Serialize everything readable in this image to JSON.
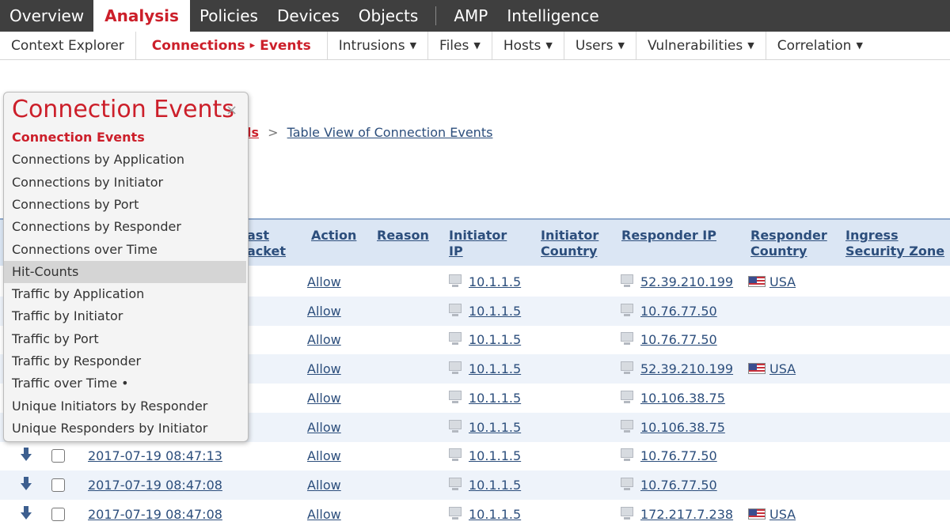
{
  "topnav": {
    "items": [
      "Overview",
      "Analysis",
      "Policies",
      "Devices",
      "Objects",
      "AMP",
      "Intelligence"
    ],
    "active": "Analysis"
  },
  "subnav": {
    "context_explorer": "Context Explorer",
    "connections": "Connections",
    "events": "Events",
    "arrow": "▸",
    "intrusions": "Intrusions",
    "files": "Files",
    "hosts": "Hosts",
    "users": "Users",
    "vulnerabilities": "Vulnerabilities",
    "correlation": "Correlation",
    "caret": "▼"
  },
  "breadcrumb": {
    "partial": "ls",
    "separator": ">",
    "current": "Table View of Connection Events"
  },
  "dropdown": {
    "title": "Connection Events",
    "close": "×",
    "items": [
      "Connection Events",
      "Connections by Application",
      "Connections by Initiator",
      "Connections by Port",
      "Connections by Responder",
      "Connections over Time",
      "Hit-Counts",
      "Traffic by Application",
      "Traffic by Initiator",
      "Traffic by Port",
      "Traffic by Responder",
      "Traffic over Time •",
      "Unique Initiators by Responder",
      "Unique Responders by Initiator"
    ]
  },
  "table": {
    "headers": {
      "last_packet_1": "ast",
      "last_packet_2": "acket",
      "action": "Action",
      "reason": "Reason",
      "initiator_ip_1": "Initiator",
      "initiator_ip_2": "IP",
      "initiator_country_1": "Initiator",
      "initiator_country_2": "Country",
      "responder_ip": "Responder IP",
      "responder_country_1": "Responder",
      "responder_country_2": "Country",
      "ingress_zone_1": "Ingress",
      "ingress_zone_2": "Security Zone"
    },
    "rows": [
      {
        "time": "",
        "action": "Allow",
        "initiator_ip": "10.1.1.5",
        "responder_ip": "52.39.210.199",
        "responder_country": "USA"
      },
      {
        "time": "",
        "action": "Allow",
        "initiator_ip": "10.1.1.5",
        "responder_ip": "10.76.77.50",
        "responder_country": ""
      },
      {
        "time": "",
        "action": "Allow",
        "initiator_ip": "10.1.1.5",
        "responder_ip": "10.76.77.50",
        "responder_country": ""
      },
      {
        "time": "",
        "action": "Allow",
        "initiator_ip": "10.1.1.5",
        "responder_ip": "52.39.210.199",
        "responder_country": "USA"
      },
      {
        "time": "",
        "action": "Allow",
        "initiator_ip": "10.1.1.5",
        "responder_ip": "10.106.38.75",
        "responder_country": ""
      },
      {
        "time": "",
        "action": "Allow",
        "initiator_ip": "10.1.1.5",
        "responder_ip": "10.106.38.75",
        "responder_country": ""
      },
      {
        "time": "2017-07-19 08:47:13",
        "action": "Allow",
        "initiator_ip": "10.1.1.5",
        "responder_ip": "10.76.77.50",
        "responder_country": ""
      },
      {
        "time": "2017-07-19 08:47:08",
        "action": "Allow",
        "initiator_ip": "10.1.1.5",
        "responder_ip": "10.76.77.50",
        "responder_country": ""
      },
      {
        "time": "2017-07-19 08:47:08",
        "action": "Allow",
        "initiator_ip": "10.1.1.5",
        "responder_ip": "172.217.7.238",
        "responder_country": "USA"
      }
    ]
  },
  "colors": {
    "accent_red": "#cc1f2a",
    "link_blue": "#2c4e7c",
    "nav_dark": "#3f3f3f",
    "header_blue": "#dbe6f4"
  }
}
